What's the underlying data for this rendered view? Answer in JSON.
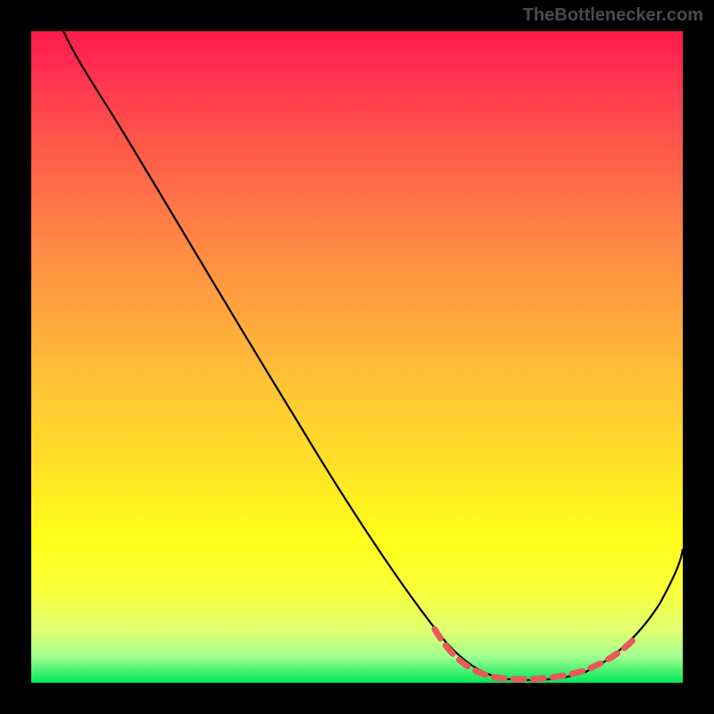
{
  "watermark": "TheBottlenecker.com",
  "chart_data": {
    "type": "line",
    "title": "",
    "xlabel": "",
    "ylabel": "",
    "xlim": [
      0,
      100
    ],
    "ylim": [
      0,
      100
    ],
    "series": [
      {
        "name": "curve",
        "x": [
          5,
          10,
          15,
          20,
          25,
          30,
          35,
          40,
          45,
          50,
          55,
          60,
          65,
          68,
          72,
          76,
          80,
          84,
          88,
          92,
          96,
          100
        ],
        "y": [
          100,
          94,
          87,
          79,
          71,
          63,
          55,
          47,
          39,
          31,
          24,
          17,
          10,
          6,
          3,
          1.5,
          1,
          1.5,
          4,
          8,
          14,
          21
        ]
      }
    ],
    "highlight_region": {
      "name": "optimal-zone",
      "x_start": 63,
      "x_end": 93,
      "note": "dashed pink segment near minimum"
    },
    "background_gradient": {
      "top": "#ff1a4a",
      "middle": "#ffe028",
      "bottom": "#00e858"
    }
  }
}
